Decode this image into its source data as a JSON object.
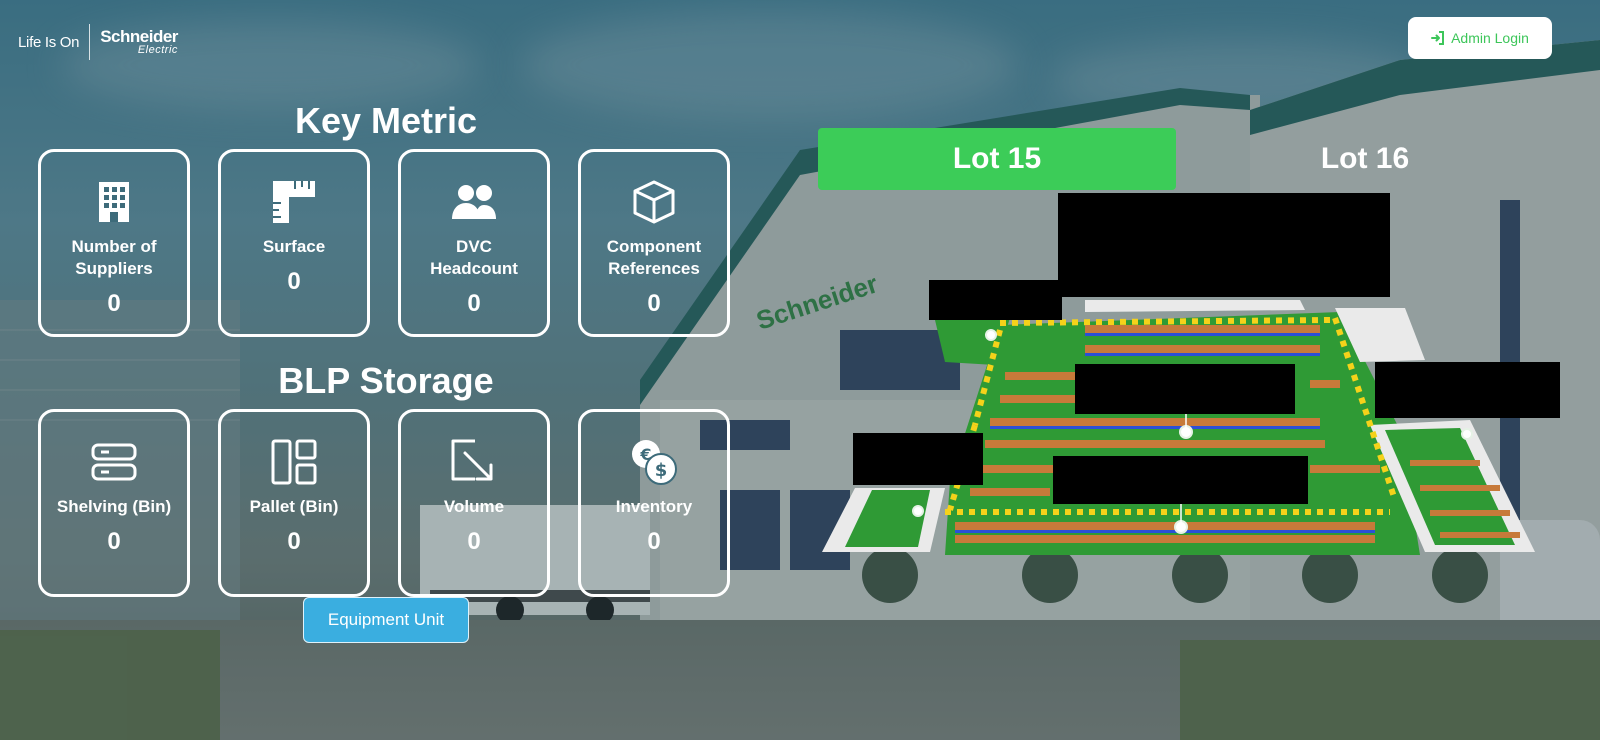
{
  "header": {
    "tagline": "Life Is On",
    "brand_name": "Schneider",
    "brand_sub": "Electric",
    "admin_login_label": "Admin Login"
  },
  "key_metric": {
    "title": "Key Metric",
    "cards": [
      {
        "label_line1": "Number of",
        "label_line2": "Suppliers",
        "value": "0",
        "icon": "building-icon"
      },
      {
        "label_line1": "Surface",
        "label_line2": "",
        "value": "0",
        "icon": "ruler-icon"
      },
      {
        "label_line1": "DVC",
        "label_line2": "Headcount",
        "value": "0",
        "icon": "users-icon"
      },
      {
        "label_line1": "Component",
        "label_line2": "References",
        "value": "0",
        "icon": "cube-icon"
      }
    ]
  },
  "blp_storage": {
    "title": "BLP Storage",
    "cards": [
      {
        "label": "Shelving (Bin)",
        "value": "0",
        "icon": "server-icon"
      },
      {
        "label": "Pallet (Bin)",
        "value": "0",
        "icon": "layout-icon"
      },
      {
        "label": "Volume",
        "value": "0",
        "icon": "arrow-down-right-icon"
      },
      {
        "label": "Inventory",
        "value": "0",
        "icon": "currency-coins-icon"
      }
    ]
  },
  "equipment_button_label": "Equipment Unit",
  "lots": [
    {
      "label": "Lot 15",
      "active": true
    },
    {
      "label": "Lot 16",
      "active": false
    }
  ],
  "colors": {
    "accent_green": "#3ccc58",
    "button_blue": "#3aaee0",
    "floor_green": "#2f9a35"
  }
}
